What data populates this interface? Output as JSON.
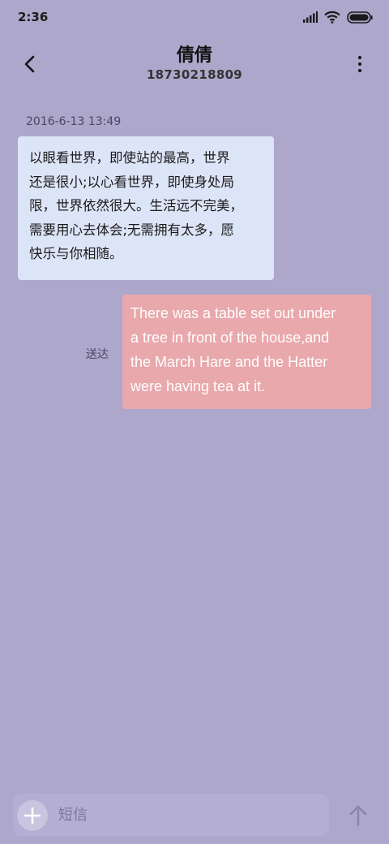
{
  "status_bar": {
    "time": "2:36",
    "icons": [
      "signal-icon",
      "wifi-icon",
      "battery-icon"
    ]
  },
  "header": {
    "back_icon": "back-arrow-icon",
    "contact_name": "倩倩",
    "contact_number": "18730218809",
    "more_icon": "more-vertical-icon"
  },
  "conversation": {
    "timestamp": "2016-6-13 13:49",
    "received_message": {
      "lines": [
        "以眼看世界，即使站的最高，世界",
        "还是很小;以心看世界，即使身处局",
        "限，世界依然很大。生活远不完美，",
        "需要用心去体会;无需拥有太多，愿",
        "快乐与你相随。"
      ]
    },
    "sent_message": {
      "lines": [
        "There was a table set out under",
        "a tree in front of the house,and",
        "the March Hare and the Hatter",
        "were having tea at it."
      ],
      "status": "送达"
    }
  },
  "composer": {
    "add_icon": "plus-icon",
    "placeholder": "短信",
    "send_icon": "send-arrow-icon"
  },
  "colors": {
    "background": "#ada7cc",
    "received_bubble": "#dce4f7",
    "sent_bubble": "#e9a8ac",
    "composer": "#b3aed2"
  }
}
